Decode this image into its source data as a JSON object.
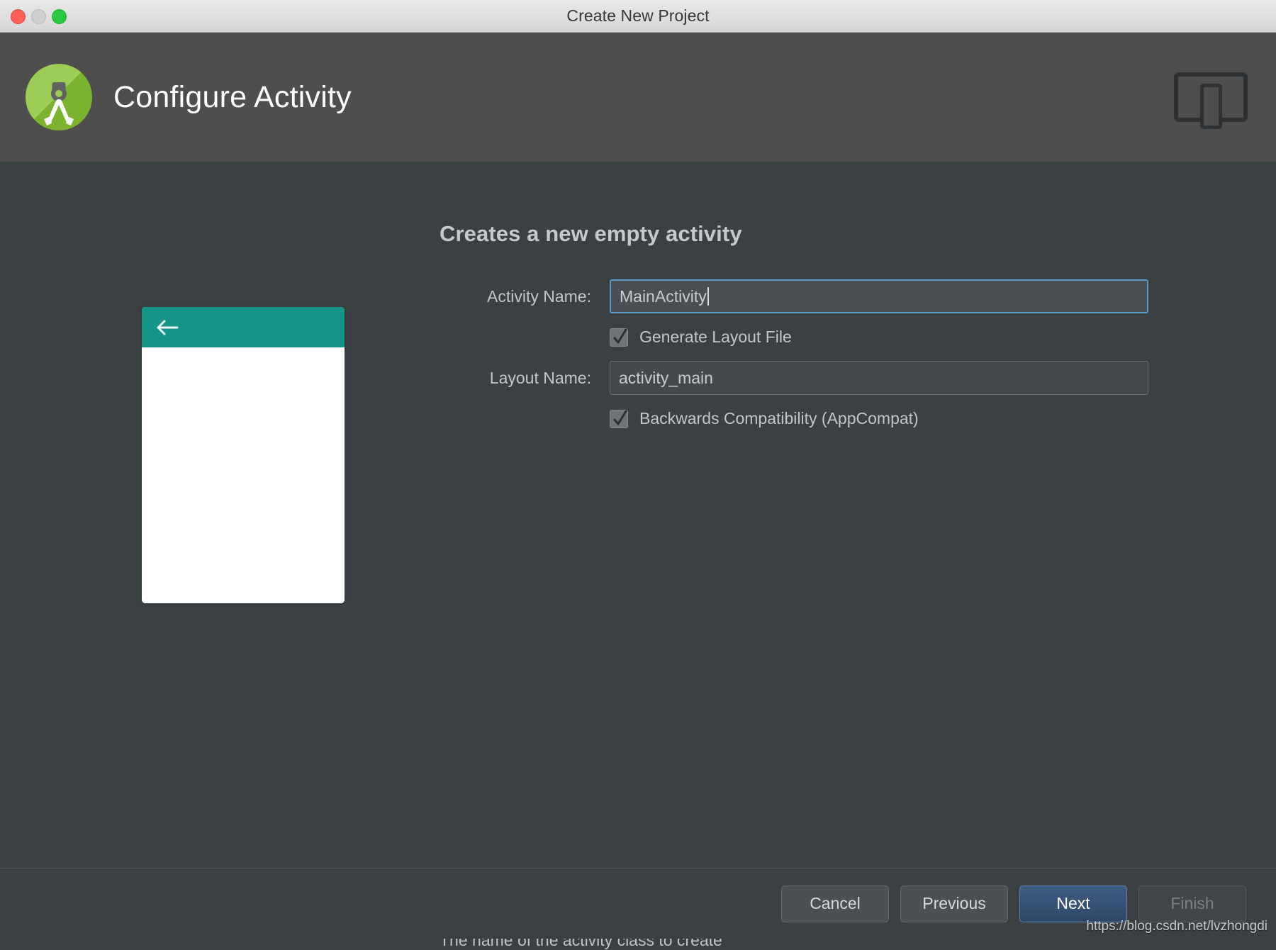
{
  "window": {
    "title": "Create New Project",
    "traffic_lights": [
      "close",
      "minimize",
      "maximize"
    ]
  },
  "header": {
    "title": "Configure Activity",
    "logo_icon": "android-studio-logo",
    "device_icon": "tablet-and-phone-icon"
  },
  "preview": {
    "back_icon": "arrow-left-icon",
    "appbar_color": "#159588",
    "canvas_color": "#ffffff"
  },
  "form": {
    "heading": "Creates a new empty activity",
    "activity_name": {
      "label": "Activity Name:",
      "value": "MainActivity",
      "placeholder": "MainActivity",
      "focused": true
    },
    "generate_layout": {
      "label": "Generate Layout File",
      "checked": true
    },
    "layout_name": {
      "label": "Layout Name:",
      "value": "activity_main",
      "placeholder": "activity_main",
      "focused": false
    },
    "backwards_compat": {
      "label": "Backwards Compatibility (AppCompat)",
      "checked": true
    },
    "hint": "The name of the activity class to create"
  },
  "footer": {
    "cancel": "Cancel",
    "previous": "Previous",
    "next": "Next",
    "finish": "Finish"
  },
  "watermark": "https://blog.csdn.net/lvzhongdi",
  "colors": {
    "header_band": "#4e4e4e",
    "body": "#3b4043",
    "accent_teal": "#159588",
    "focus_blue": "#5b97cc",
    "primary_button": "#2e4766"
  }
}
